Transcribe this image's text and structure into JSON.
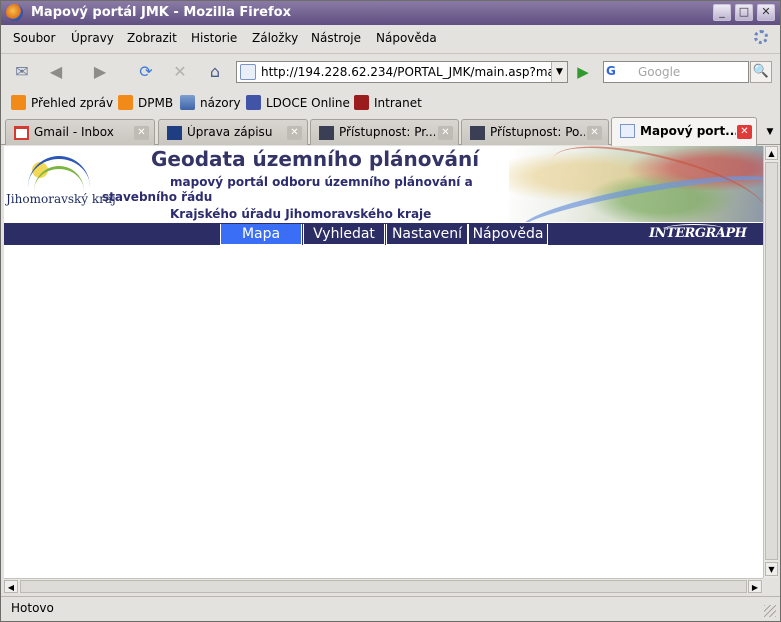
{
  "window": {
    "title": "Mapový portál JMK - Mozilla Firefox",
    "controls": {
      "minimize": "_",
      "maximize": "□",
      "close": "✕"
    }
  },
  "menu": [
    "Soubor",
    "Úpravy",
    "Zobrazit",
    "Historie",
    "Záložky",
    "Nástroje",
    "Nápověda"
  ],
  "toolbar": {
    "back": "◀",
    "forward": "▶",
    "reload": "⟳",
    "stop": "✕",
    "home": "⌂",
    "url": "http://194.228.62.234/PORTAL_JMK/main.asp?map",
    "url_dropdown": "▼",
    "go": "▶",
    "search_engine": "G",
    "search_placeholder": "Google",
    "search_go": "🔍"
  },
  "bookmarks": [
    {
      "label": "Přehled zpráv",
      "icon": "rss-icon"
    },
    {
      "label": "DPMB",
      "icon": "rss-icon"
    },
    {
      "label": "názory",
      "icon": "folder-icon"
    },
    {
      "label": "LDOCE Online",
      "icon": "ldoce-icon"
    },
    {
      "label": "Intranet",
      "icon": "fist-icon"
    }
  ],
  "tabs": [
    {
      "label": "Gmail - Inbox",
      "icon": "gmail-icon",
      "active": false
    },
    {
      "label": "Úprava zápisu",
      "icon": "edit-icon",
      "active": false
    },
    {
      "label": "Přístupnost: Pr...",
      "icon": "accessibility-icon",
      "active": false
    },
    {
      "label": "Přístupnost: Po...",
      "icon": "accessibility-icon",
      "active": false
    },
    {
      "label": "Mapový port...",
      "icon": "page-icon",
      "active": true
    }
  ],
  "tab_close": "✕",
  "tab_list": "▼",
  "page": {
    "logo_text": "Jihomoravský kraj",
    "title": "Geodata územního plánování",
    "subtitle_line1": "mapový portál odboru územního plánování a",
    "subtitle_line2": "stavebního řádu",
    "subtitle_line3": "Krajského úřadu Jihomoravského kraje",
    "nav": [
      {
        "label": "Mapa",
        "active": true
      },
      {
        "label": "Vyhledat",
        "active": false
      },
      {
        "label": "Nastavení",
        "active": false
      },
      {
        "label": "Nápověda",
        "active": false
      }
    ],
    "vendor_logo": "INTERGRAPH"
  },
  "scroll": {
    "up": "▲",
    "down": "▼",
    "left": "◀",
    "right": "▶"
  },
  "status": "Hotovo",
  "colors": {
    "titlebar": "#5f4e81",
    "nav_band": "#2d2d66",
    "nav_active": "#3b6ef7",
    "page_title": "#343466"
  }
}
